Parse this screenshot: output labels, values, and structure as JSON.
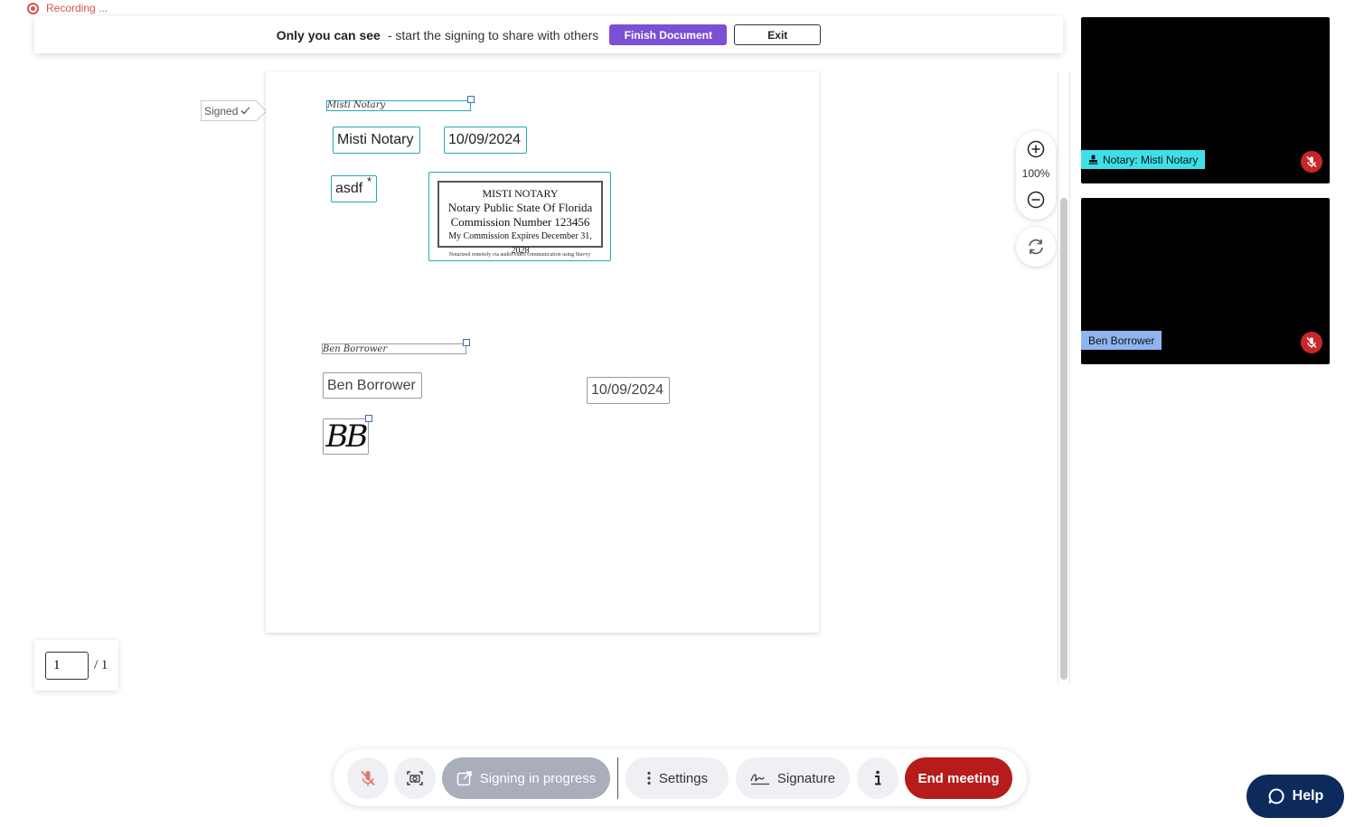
{
  "recording": {
    "label": "Recording ..."
  },
  "banner": {
    "bold_text": "Only you can see",
    "sub_text": "- start the signing to share with others",
    "finish_label": "Finish Document",
    "exit_label": "Exit"
  },
  "document": {
    "signed_tag": "Signed",
    "notary_signature": "Misti Notary",
    "notary_name": "Misti Notary",
    "notary_date": "10/09/2024",
    "notary_initial_field": "asdf",
    "required_mark": "*",
    "seal": {
      "line1": "MISTI NOTARY",
      "line2": "Notary Public State Of Florida",
      "line3": "Commission Number 123456",
      "line4": "My Commission Expires December 31, 2028",
      "footer": "Notarized remotely via audio/video communication using Stavvy"
    },
    "borrower_signature": "Ben Borrower",
    "borrower_name": "Ben Borrower",
    "borrower_date": "10/09/2024",
    "borrower_initials": "BB"
  },
  "zoom": {
    "level": "100%"
  },
  "pager": {
    "current": "1",
    "total": "/ 1"
  },
  "participants": [
    {
      "label": "Notary: Misti Notary",
      "tag_color": "#3ee0e8",
      "icon": "stamp-icon"
    },
    {
      "label": "Ben Borrower",
      "tag_color": "#8fb5f0"
    }
  ],
  "toolbar": {
    "signing_label": "Signing in progress",
    "settings_label": "Settings",
    "signature_label": "Signature",
    "end_label": "End meeting"
  },
  "help": {
    "label": "Help"
  },
  "colors": {
    "accent": "#7b4fd6",
    "end": "#b71c1c",
    "help": "#0d2a5c",
    "field_border": "#29a7b5"
  }
}
